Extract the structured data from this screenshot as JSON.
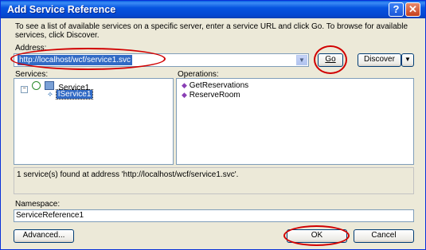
{
  "window": {
    "title": "Add Service Reference",
    "help_glyph": "?",
    "close_glyph": "✕"
  },
  "description": "To see a list of available services on a specific server, enter a service URL and click Go. To browse for available services, click Discover.",
  "address": {
    "label": "Address:",
    "value": "http://localhost/wcf/service1.svc"
  },
  "buttons": {
    "go": "Go",
    "discover": "Discover",
    "advanced": "Advanced...",
    "ok": "OK",
    "cancel": "Cancel"
  },
  "services": {
    "label": "Services:",
    "root": "Service1",
    "child": "IService1"
  },
  "operations": {
    "label": "Operations:",
    "items": [
      "GetReservations",
      "ReserveRoom"
    ]
  },
  "status": "1 service(s) found at address 'http://localhost/wcf/service1.svc'.",
  "namespace": {
    "label": "Namespace:",
    "value": "ServiceReference1"
  },
  "colors": {
    "highlight_ellipse": "#d10000",
    "selection": "#316ac5",
    "title_bar": "#0654e0"
  }
}
